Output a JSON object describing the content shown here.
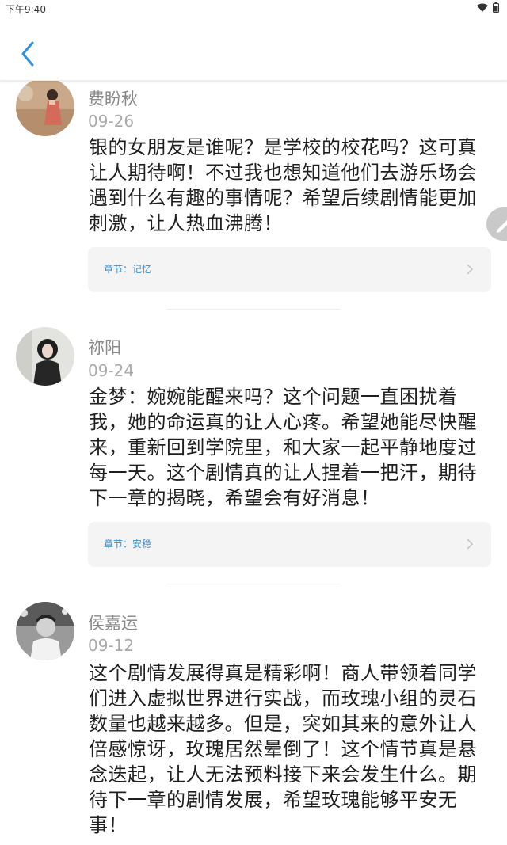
{
  "status_bar": {
    "time": "下午9:40",
    "icons": [
      "wifi-icon",
      "battery-icon"
    ]
  },
  "header": {
    "back_icon": "chevron-left-icon",
    "accent_color": "#2f8fe0"
  },
  "comments": [
    {
      "author": "费盼秋",
      "date": "09-26",
      "text": "银的女朋友是谁呢？是学校的校花吗？这可真让人期待啊！不过我也想知道他们去游乐场会遇到什么有趣的事情呢？希望后续剧情能更加刺激，让人热血沸腾！",
      "chapter": "章节：记忆"
    },
    {
      "author": "祢阳",
      "date": "09-24",
      "text": "金梦：婉婉能醒来吗？这个问题一直困扰着我，她的命运真的让人心疼。希望她能尽快醒来，重新回到学院里，和大家一起平静地度过每一天。这个剧情真的让人捏着一把汗，期待下一章的揭晓，希望会有好消息！",
      "chapter": "章节：安稳"
    },
    {
      "author": "侯嘉运",
      "date": "09-12",
      "text": "这个剧情发展得真是精彩啊！商人带领着同学们进入虚拟世界进行实战，而玫瑰小组的灵石数量也越来越多。但是，突如其来的意外让人倍感惊讶，玫瑰居然晕倒了！这个情节真是悬念迭起，让人无法预料接下来会发生什么。期待下一章的剧情发展，希望玫瑰能够平安无事！"
    }
  ],
  "floating_button": {
    "icon": "pencil-icon"
  }
}
